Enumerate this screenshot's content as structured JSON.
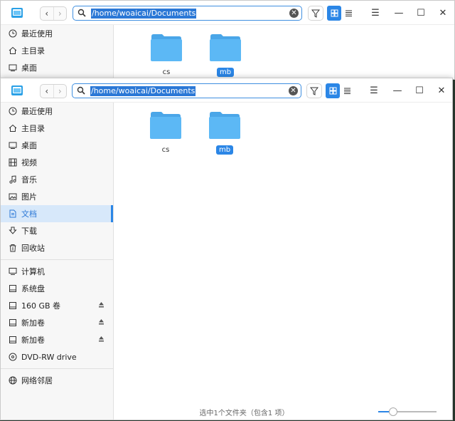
{
  "address": {
    "path": "/home/woaicai/Documents"
  },
  "sidebar": {
    "items": [
      {
        "label": "最近使用",
        "icon": "clock-icon"
      },
      {
        "label": "主目录",
        "icon": "home-icon"
      },
      {
        "label": "桌面",
        "icon": "desktop-icon"
      },
      {
        "label": "视频",
        "icon": "video-icon"
      },
      {
        "label": "音乐",
        "icon": "music-icon"
      },
      {
        "label": "图片",
        "icon": "picture-icon"
      },
      {
        "label": "文档",
        "icon": "document-icon"
      },
      {
        "label": "下载",
        "icon": "download-icon"
      },
      {
        "label": "回收站",
        "icon": "trash-icon"
      },
      {
        "label": "计算机",
        "icon": "computer-icon"
      },
      {
        "label": "系统盘",
        "icon": "disk-icon"
      },
      {
        "label": "160 GB 卷",
        "icon": "disk-icon"
      },
      {
        "label": "新加卷",
        "icon": "disk-icon"
      },
      {
        "label": "新加卷",
        "icon": "disk-icon"
      },
      {
        "label": "DVD-RW drive",
        "icon": "disc-icon"
      },
      {
        "label": "网络邻居",
        "icon": "network-icon"
      }
    ],
    "active_index": 6
  },
  "files": [
    {
      "name": "cs",
      "selected": false
    },
    {
      "name": "mb",
      "selected": true
    }
  ],
  "status": {
    "text": "选中1个文件夹（包含1 项）"
  },
  "zoom": {
    "level": 0.25
  },
  "colors": {
    "accent": "#2b86e6",
    "folder": "#5cb8f5",
    "folder_tab": "#4aa6e8"
  }
}
